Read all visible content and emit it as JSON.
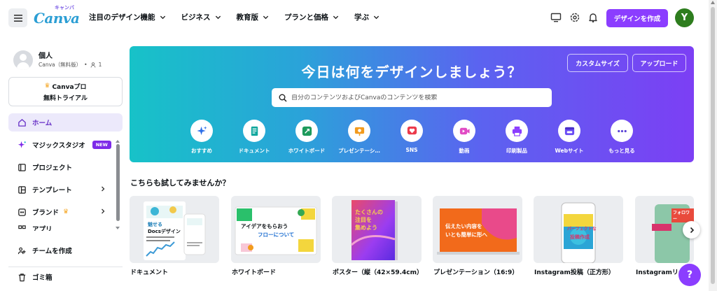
{
  "header": {
    "logo_text": "Canva",
    "logo_kana": "キャンバ",
    "nav": [
      {
        "label": "注目のデザイン機能"
      },
      {
        "label": "ビジネス"
      },
      {
        "label": "教育版"
      },
      {
        "label": "プランと価格"
      },
      {
        "label": "学ぶ"
      }
    ],
    "create_label": "デザインを作成",
    "avatar_initial": "Y",
    "icons": [
      "desktop-icon",
      "settings-icon",
      "bell-icon"
    ],
    "accent_color": "#8b3dff",
    "avatar_color": "#2e7d1e"
  },
  "sidebar": {
    "profile_name": "個人",
    "profile_plan": "Canva（無料版）",
    "member_count": "1",
    "trial_line1": "Canvaプロ",
    "trial_line2": "無料トライアル",
    "items": [
      {
        "label": "ホーム",
        "icon": "home-icon"
      },
      {
        "label": "マジックスタジオ",
        "icon": "sparkle-icon",
        "badge": "NEW"
      },
      {
        "label": "プロジェクト",
        "icon": "folder-icon"
      },
      {
        "label": "テンプレート",
        "icon": "template-icon"
      },
      {
        "label": "ブランド",
        "icon": "brand-icon"
      },
      {
        "label": "アプリ",
        "icon": "apps-icon"
      },
      {
        "label": "チームを作成",
        "icon": "team-icon"
      },
      {
        "label": "ゴミ箱",
        "icon": "trash-icon"
      }
    ]
  },
  "hero": {
    "title": "今日は何をデザインしましょう？",
    "custom_size": "カスタムサイズ",
    "upload": "アップロード",
    "search_placeholder": "自分のコンテンツおよびCanvaのコンテンツを検索",
    "categories": [
      {
        "label": "おすすめ",
        "icon": "sparkles-icon",
        "color": "#2d6fe8"
      },
      {
        "label": "ドキュメント",
        "icon": "document-icon",
        "color": "#13a89e"
      },
      {
        "label": "ホワイトボード",
        "icon": "whiteboard-icon",
        "color": "#1d9a5b"
      },
      {
        "label": "プレゼンテーシ…",
        "icon": "presentation-icon",
        "color": "#f29b1e"
      },
      {
        "label": "SNS",
        "icon": "heart-icon",
        "color": "#ec3a4b"
      },
      {
        "label": "動画",
        "icon": "video-icon",
        "color": "#e14bc4"
      },
      {
        "label": "印刷製品",
        "icon": "printer-icon",
        "color": "#8b3dff"
      },
      {
        "label": "Webサイト",
        "icon": "website-icon",
        "color": "#6a4cf5"
      },
      {
        "label": "もっと見る",
        "icon": "more-icon",
        "color": "#5b43d6"
      }
    ]
  },
  "suggestions": {
    "title": "こちらも試してみませんか？",
    "cards": [
      {
        "label": "ドキュメント",
        "thumb_text_1": "魅せる",
        "thumb_text_2": "Docsデザイン"
      },
      {
        "label": "ホワイトボード",
        "thumb_text_1": "アイデアをもらおう",
        "thumb_text_2": "フローについて"
      },
      {
        "label": "ポスター（縦（42×59.4cm）…",
        "thumb_text_1": "たくさんの",
        "thumb_text_2": "注目を",
        "thumb_text_3": "集めよう"
      },
      {
        "label": "プレゼンテーション（16:9）",
        "thumb_text_1": "伝えたい内容を",
        "thumb_text_2": "いとも簡単に形へ"
      },
      {
        "label": "Instagram投稿（正方形）",
        "thumb_text_1": "パーフェクトな",
        "thumb_text_2": "投稿作成"
      },
      {
        "label": "Instagramリー…",
        "thumb_text_1": "フォロワー"
      }
    ]
  },
  "help_label": "?"
}
